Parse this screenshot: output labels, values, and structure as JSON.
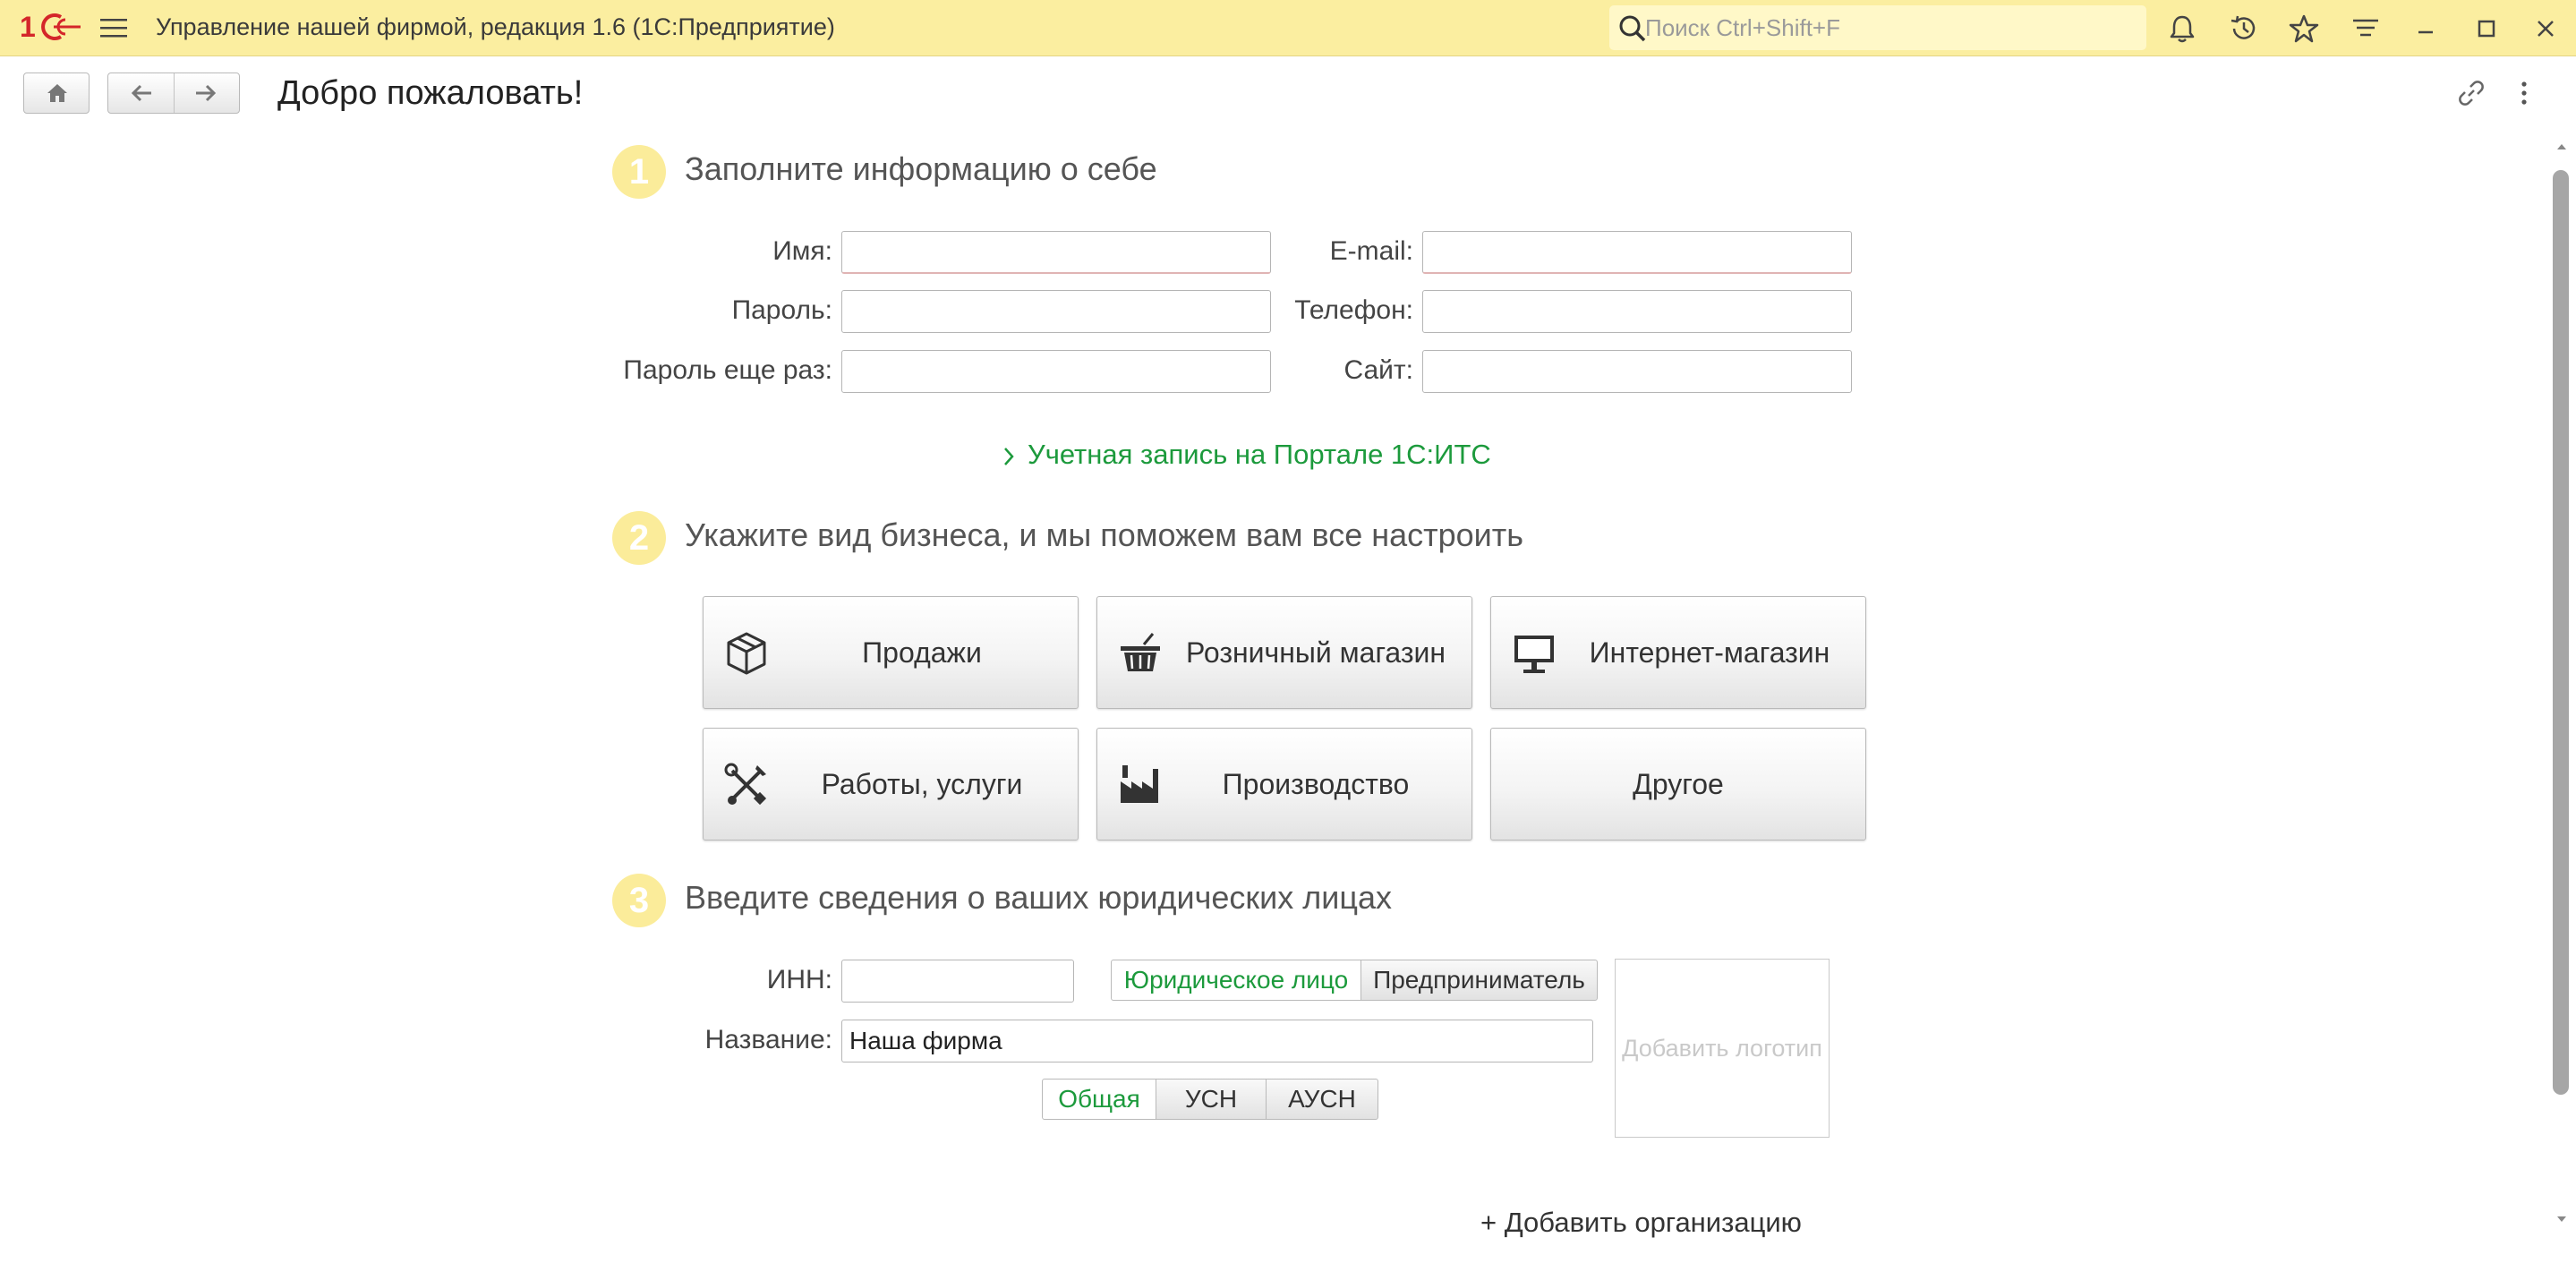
{
  "window": {
    "title": "Управление нашей фирмой, редакция 1.6  (1С:Предприятие)",
    "search_placeholder": "Поиск Ctrl+Shift+F"
  },
  "icons": {
    "logo": "1c-logo-icon",
    "menu": "hamburger-menu-icon",
    "search": "search-icon",
    "toolbar": [
      "bell-icon",
      "history-icon",
      "star-icon",
      "funnel-icon",
      "minimize-icon",
      "maximize-icon",
      "close-icon"
    ],
    "nav": [
      "home-icon",
      "back-arrow-icon",
      "forward-arrow-icon"
    ],
    "page": [
      "link-icon",
      "more-vertical-icon"
    ]
  },
  "colors": {
    "titlebar": "#fbeea0",
    "step_badge": "#fbec9a",
    "link_green": "#1c9a3c",
    "logo_red": "#d4262a"
  },
  "page": {
    "title": "Добро пожаловать!"
  },
  "step1": {
    "number": "1",
    "title": "Заполните информацию о себе",
    "fields": {
      "name_label": "Имя:",
      "password_label": "Пароль:",
      "password_again_label": "Пароль еще раз:",
      "email_label": "E-mail:",
      "phone_label": "Телефон:",
      "site_label": "Сайт:",
      "name_value": "",
      "password_value": "",
      "password_again_value": "",
      "email_value": "",
      "phone_value": "",
      "site_value": ""
    },
    "its_link": "Учетная запись на Портале 1С:ИТС"
  },
  "step2": {
    "number": "2",
    "title": "Укажите вид бизнеса, и мы поможем вам все настроить",
    "tiles": [
      {
        "label": "Продажи",
        "icon": "box-icon"
      },
      {
        "label": "Розничный магазин",
        "icon": "basket-icon"
      },
      {
        "label": "Интернет-магазин",
        "icon": "monitor-icon"
      },
      {
        "label": "Работы, услуги",
        "icon": "tools-icon"
      },
      {
        "label": "Производство",
        "icon": "factory-icon"
      },
      {
        "label": "Другое",
        "icon": ""
      }
    ]
  },
  "step3": {
    "number": "3",
    "title": "Введите сведения о ваших юридических лицах",
    "inn_label": "ИНН:",
    "inn_value": "",
    "name_label": "Название:",
    "name_value": "Наша фирма",
    "entity_types": [
      "Юридическое лицо",
      "Предприниматель"
    ],
    "entity_selected": "Юридическое лицо",
    "tax_systems": [
      "Общая",
      "УСН",
      "АУСН"
    ],
    "tax_selected": "Общая",
    "logo_placeholder": "Добавить логотип",
    "add_org": "+ Добавить организацию"
  }
}
